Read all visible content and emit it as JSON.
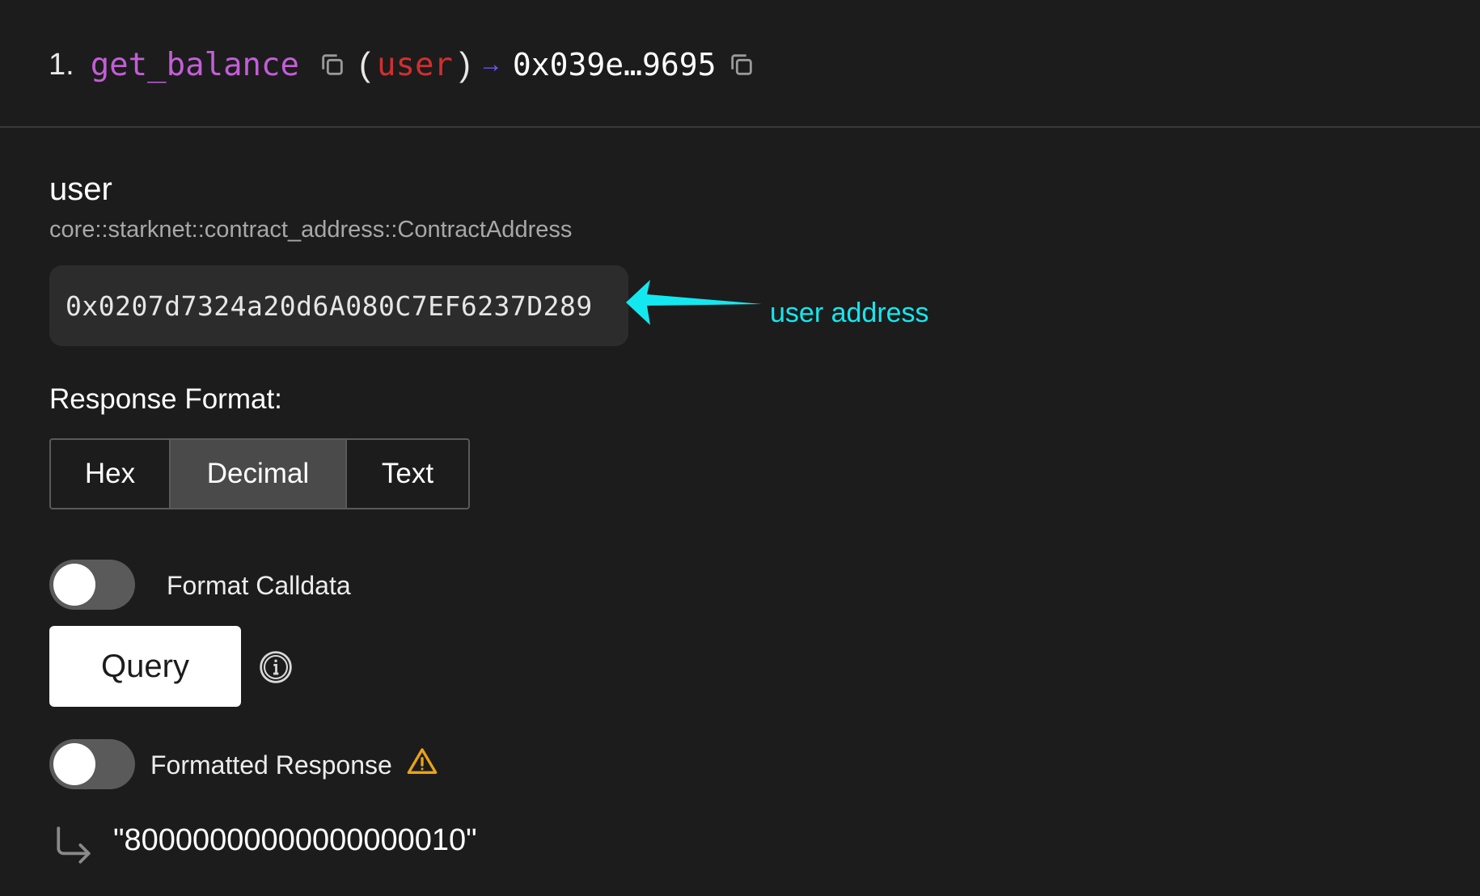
{
  "header": {
    "index": "1.",
    "function_name": "get_balance",
    "open_paren": "(",
    "param": "user",
    "close_paren": ")",
    "arrow": "→",
    "return_address": "0x039e…9695"
  },
  "param_block": {
    "name": "user",
    "type": "core::starknet::contract_address::ContractAddress",
    "value": "0x0207d7324a20d6A080C7EF6237D289"
  },
  "annotation": {
    "label": "user address",
    "color": "#13e8f0"
  },
  "response_format": {
    "label": "Response Format:",
    "options": [
      "Hex",
      "Decimal",
      "Text"
    ],
    "selected": "Decimal"
  },
  "format_calldata": {
    "label": "Format Calldata",
    "on": false
  },
  "query": {
    "label": "Query"
  },
  "formatted_response": {
    "label": "Formatted Response",
    "on": false
  },
  "result": {
    "value": "\"80000000000000000010\""
  },
  "colors": {
    "background": "#1c1c1c",
    "function_name": "#c35ed8",
    "param": "#d12f2f",
    "arrow": "#6b5cff",
    "warning": "#e8a317"
  }
}
